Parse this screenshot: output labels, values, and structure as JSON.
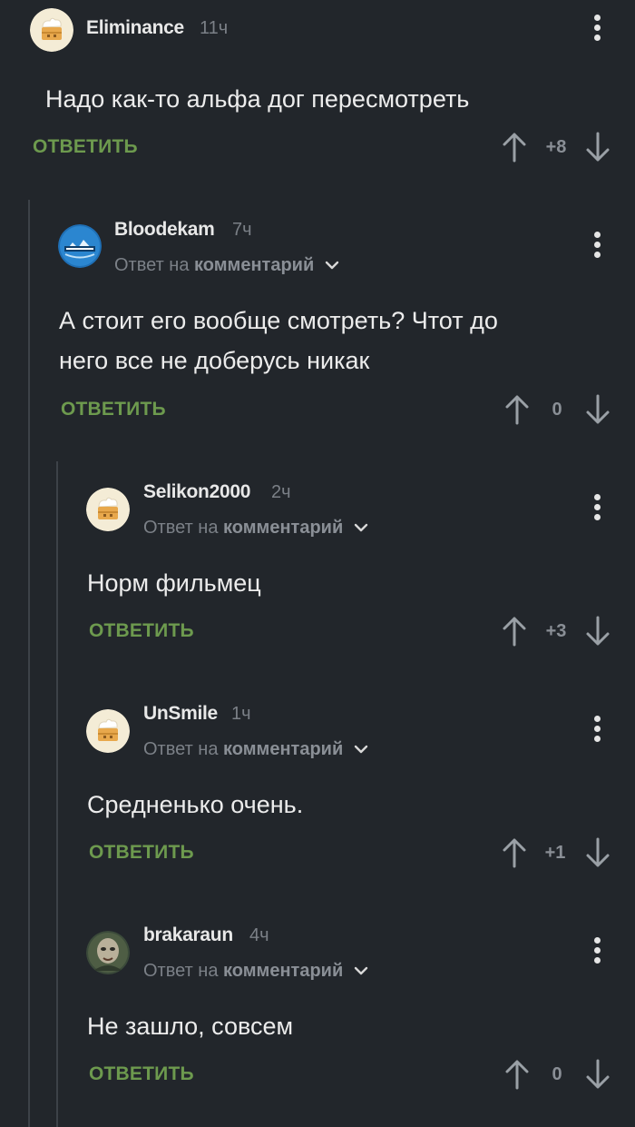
{
  "comments": [
    {
      "username": "Eliminance",
      "time": "11ч",
      "text_lines": [
        "Надо как-то альфа дог пересмотреть"
      ],
      "rating": "+8",
      "reply_label": "ОТВЕТИТЬ"
    },
    {
      "username": "Bloodekam",
      "time": "7ч",
      "reply_prefix": "Ответ на",
      "reply_target": "комментарий",
      "text_lines": [
        "А стоит его вообще смотреть? Чтот до",
        "него все не доберусь никак"
      ],
      "rating": "0",
      "reply_label": "ОТВЕТИТЬ"
    },
    {
      "username": "Selikon2000",
      "time": "2ч",
      "reply_prefix": "Ответ на",
      "reply_target": "комментарий",
      "text_lines": [
        "Норм фильмец"
      ],
      "rating": "+3",
      "reply_label": "ОТВЕТИТЬ"
    },
    {
      "username": "UnSmile",
      "time": "1ч",
      "reply_prefix": "Ответ на",
      "reply_target": "комментарий",
      "text_lines": [
        "Средненько очень."
      ],
      "rating": "+1",
      "reply_label": "ОТВЕТИТЬ"
    },
    {
      "username": "brakaraun",
      "time": "4ч",
      "reply_prefix": "Ответ на",
      "reply_target": "комментарий",
      "text_lines": [
        "Не зашло, совсем"
      ],
      "rating": "0",
      "reply_label": "ОТВЕТИТЬ"
    }
  ],
  "icons": {
    "menu": "kebab-menu-icon",
    "upvote": "arrow-up-icon",
    "downvote": "arrow-down-icon",
    "expand": "chevron-down-icon",
    "default_avatar": "cake-avatar-icon"
  },
  "colors": {
    "background": "#22262b",
    "reply_button": "#6d9a4e",
    "thread_line": "#3d4248",
    "username": "#e8e8e8",
    "muted": "#7b8087"
  }
}
